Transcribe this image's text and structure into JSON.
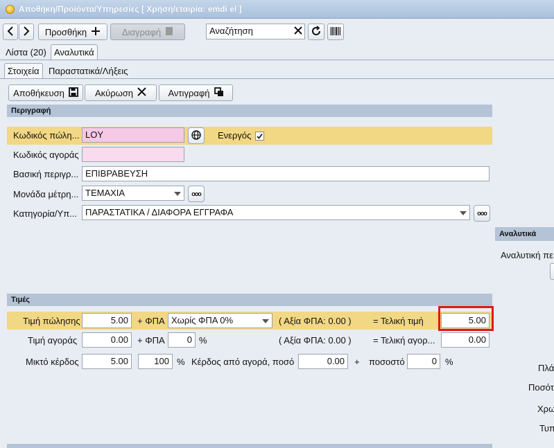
{
  "window": {
    "title": "Αποθήκη/Προϊόντα/Υπηρεσίες  [ Χρήση/εταιρία: emdi el ]"
  },
  "toolbar": {
    "add_label": "Προσθήκη",
    "delete_label": "Διαγραφή",
    "search_value": "Αναζήτηση"
  },
  "top_tabs": {
    "list_label": "Λίστα (20)",
    "detail_label": "Αναλυτικά"
  },
  "sub_tabs": {
    "info_label": "Στοιχεία",
    "docs_label": "Παραστατικά/Λήξεις"
  },
  "actions": {
    "save_label": "Αποθήκευση",
    "cancel_label": "Ακύρωση",
    "copy_label": "Αντιγραφή"
  },
  "description": {
    "header": "Περιγραφή",
    "sale_code_label": "Κωδικός πώλη...",
    "sale_code_value": "LOY",
    "active_label": "Ενεργός",
    "buy_code_label": "Κωδικός αγοράς",
    "buy_code_value": "",
    "basic_desc_label": "Βασική περιγρ...",
    "basic_desc_value": "ΕΠΙΒΡΑΒΕΥΣΗ",
    "unit_label": "Μονάδα μέτρη...",
    "unit_value": "ΤΕΜΑΧΙΑ",
    "category_label": "Κατηγορία/Υπ...",
    "category_value": "ΠΑΡΑΣΤΑΤΙΚΑ / ΔΙΑΦΟΡΑ ΕΓΓΡΑΦΑ"
  },
  "prices": {
    "header": "Τιμές",
    "sale_price_label": "Τιμή πώλησης",
    "sale_price_value": "5.00",
    "vat_label": "+ ΦΠΑ",
    "vat_select_value": "Χωρίς ΦΠΑ 0%",
    "vat_amount_sale": "( Αξία ΦΠΑ: 0.00 )",
    "final_price_label": "= Τελική τιμή",
    "final_price_value": "5.00",
    "buy_price_label": "Τιμή αγοράς",
    "buy_price_value": "0.00",
    "buy_vat_label": "+ ΦΠΑ",
    "buy_vat_value": "0",
    "percent_sign": "%",
    "vat_amount_buy": "( Αξία ΦΠΑ: 0.00 )",
    "final_buy_label": "= Τελική αγορ...",
    "final_buy_value": "0.00",
    "gross_profit_label": "Μικτό κέρδος",
    "gross_profit_value": "5.00",
    "gross_profit_pct": "100",
    "profit_from_buy_label": "Κέρδος από αγορά, ποσό",
    "profit_from_buy_value": "0.00",
    "plus_sign": "+",
    "percentage_label": "ποσοστό",
    "percentage_value": "0"
  },
  "right_panel": {
    "header": "Αναλυτικά",
    "analytic_label": "Αναλυτική πε",
    "fragments": [
      "Πλά",
      "Ποσότ",
      "Χρω",
      "Τυπ"
    ]
  },
  "colors": {
    "highlight": "#f2d884",
    "pink": "#f5c8e6",
    "section": "#b4c3d6",
    "red_outline": "#e01818"
  }
}
